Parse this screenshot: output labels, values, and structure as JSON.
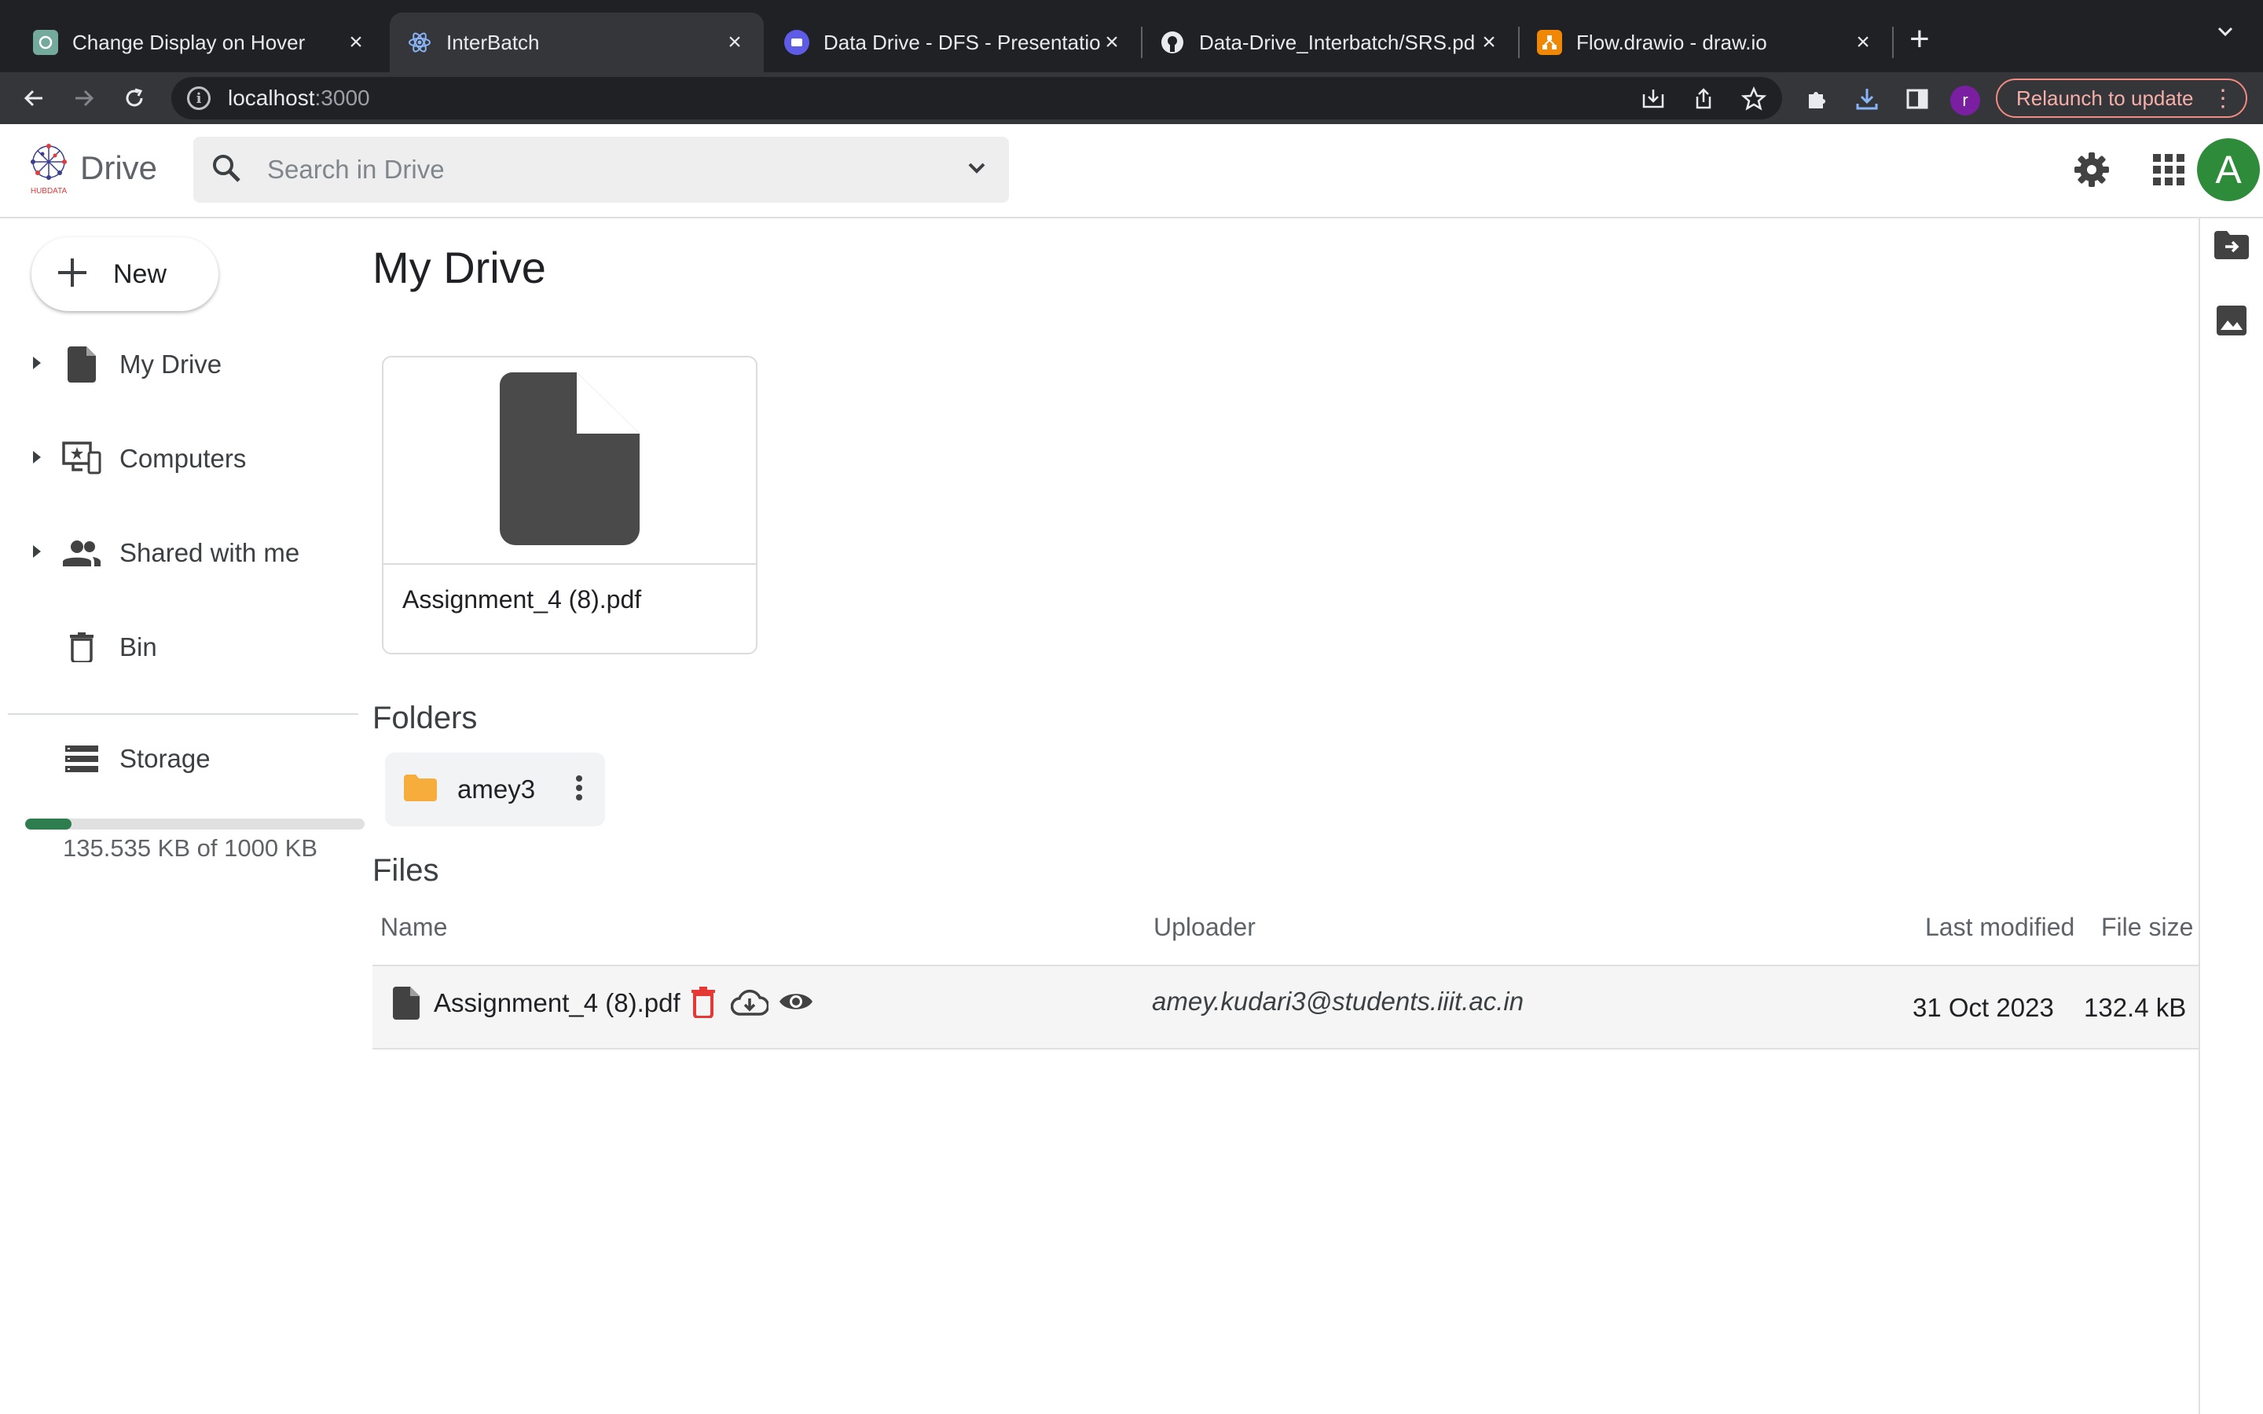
{
  "browser": {
    "tabs": [
      {
        "title": "Change Display on Hover",
        "favicon": "chatgpt-icon",
        "active": false
      },
      {
        "title": "InterBatch",
        "favicon": "react-icon",
        "active": true
      },
      {
        "title": "Data Drive - DFS - Presentatio",
        "favicon": "slides-icon",
        "active": false
      },
      {
        "title": "Data-Drive_Interbatch/SRS.pd",
        "favicon": "github-icon",
        "active": false
      },
      {
        "title": "Flow.drawio - draw.io",
        "favicon": "drawio-icon",
        "active": false
      }
    ],
    "address": {
      "host": "localhost",
      "port": ":3000"
    },
    "profile_initial": "r",
    "relaunch_label": "Relaunch to update"
  },
  "header": {
    "app_name": "Drive",
    "logo_text": "HUBDATA",
    "search_placeholder": "Search in Drive",
    "avatar_initial": "A"
  },
  "sidebar": {
    "new_label": "New",
    "items": [
      {
        "label": "My Drive",
        "icon": "file-icon",
        "expandable": true
      },
      {
        "label": "Computers",
        "icon": "computers-icon",
        "expandable": true
      },
      {
        "label": "Shared with me",
        "icon": "people-icon",
        "expandable": true
      },
      {
        "label": "Bin",
        "icon": "trash-icon",
        "expandable": false
      }
    ],
    "storage": {
      "label": "Storage",
      "used_text": "135.535 KB of 1000 KB",
      "used_fraction": 0.1355
    }
  },
  "main": {
    "title": "My Drive",
    "suggested_file": {
      "name": "Assignment_4 (8).pdf"
    },
    "folders_label": "Folders",
    "folders": [
      {
        "name": "amey3"
      }
    ],
    "files_label": "Files",
    "columns": {
      "name": "Name",
      "uploader": "Uploader",
      "modified": "Last modified",
      "size": "File size"
    },
    "files": [
      {
        "name": "Assignment_4 (8).pdf",
        "uploader": "amey.kudari3@students.iiit.ac.in",
        "modified": "31 Oct 2023",
        "size": "132.4 kB"
      }
    ]
  },
  "colors": {
    "accent_green": "#2e8b3a",
    "folder": "#f6ad3c",
    "delete": "#e53935",
    "icon_gray": "#4a4a4a"
  }
}
